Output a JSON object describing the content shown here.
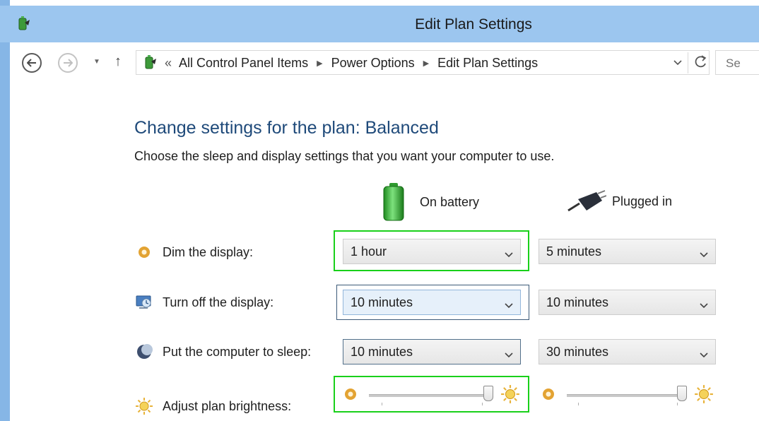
{
  "window": {
    "title": "Edit Plan Settings"
  },
  "navigation": {
    "breadcrumb": [
      "All Control Panel Items",
      "Power Options",
      "Edit Plan Settings"
    ],
    "search_placeholder": "Se"
  },
  "content": {
    "heading": "Change settings for the plan: Balanced",
    "description": "Choose the sleep and display settings that you want your computer to use.",
    "columns": {
      "battery": "On battery",
      "plugged": "Plugged in"
    },
    "rows": [
      {
        "label": "Dim the display:",
        "icon": "dim-display-icon",
        "battery": "1 hour",
        "plugged": "5 minutes"
      },
      {
        "label": "Turn off the display:",
        "icon": "monitor-icon",
        "battery": "10 minutes",
        "plugged": "10 minutes"
      },
      {
        "label": "Put the computer to sleep:",
        "icon": "moon-icon",
        "battery": "10 minutes",
        "plugged": "30 minutes"
      }
    ],
    "brightness": {
      "label": "Adjust plan brightness:",
      "battery_level_percent": 100,
      "plugged_level_percent": 100
    }
  },
  "colors": {
    "titlebar": "#9cc6ef",
    "heading": "#1f4a7a",
    "highlight": "#19d01a"
  }
}
